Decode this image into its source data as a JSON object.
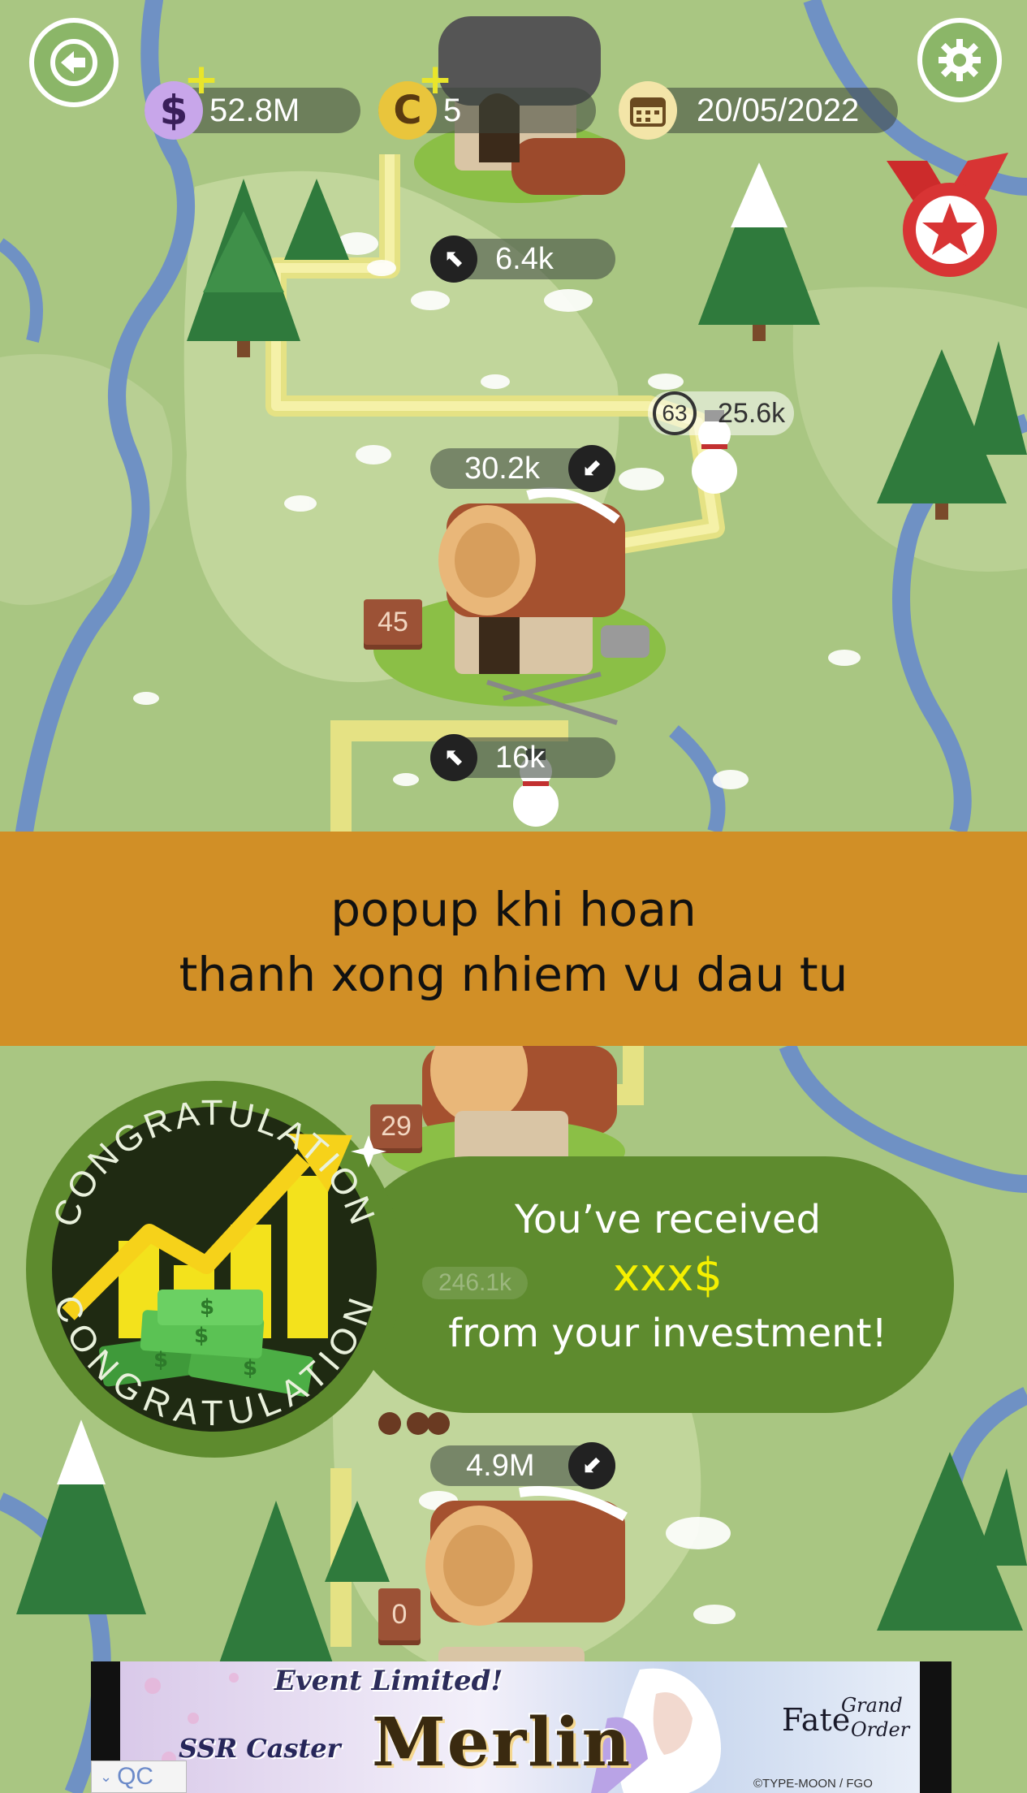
{
  "hud": {
    "money": "52.8M",
    "coins": "5",
    "date": "20/05/2022",
    "money_icon": "dollar-icon",
    "coin_icon": "coin-icon",
    "calendar_icon": "calendar-icon"
  },
  "top_map": {
    "tag_upper": "6.4k",
    "tag_mid": "30.2k",
    "tag_lower": "16k",
    "snowman_level": "63",
    "snowman_value": "25.6k",
    "building_level": "45"
  },
  "banner": {
    "line1": "popup khi hoan",
    "line2": "thanh xong nhiem vu dau tu",
    "color": "#d18f26"
  },
  "popup": {
    "badge_top_text": "CONGRATULATION",
    "badge_bottom_text": "CONGRATULATION",
    "line1": "You’ve received",
    "amount": "xxx$",
    "line3": "from your investment!",
    "bg_color": "#5e8b2e",
    "amount_color": "#f5f000"
  },
  "bottom_map": {
    "building_level_top": "29",
    "faded_tag": "246.1k",
    "tag_value": "4.9M",
    "building_level_bottom": "0"
  },
  "ad": {
    "headline": "Event Limited!",
    "subtitle_prefix": "SSR Caster",
    "title": "Merlin",
    "brand_line1": "Fate",
    "brand_line2": "Grand",
    "brand_line3": "Order",
    "copyright": "©TYPE-MOON / FGO PROJECT",
    "qc_label": "QC"
  }
}
